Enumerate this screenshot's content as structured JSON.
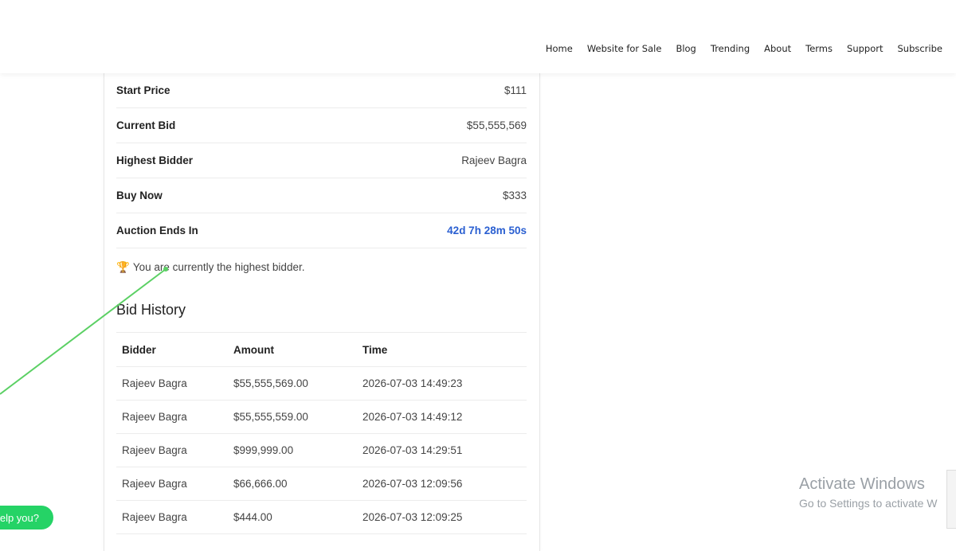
{
  "nav": {
    "items": [
      "Home",
      "Website for Sale",
      "Blog",
      "Trending",
      "About",
      "Terms",
      "Support",
      "Subscribe"
    ]
  },
  "auction": {
    "rows": [
      {
        "label": "Start Price",
        "value": "$111"
      },
      {
        "label": "Current Bid",
        "value": "$55,555,569"
      },
      {
        "label": "Highest Bidder",
        "value": "Rajeev Bagra"
      },
      {
        "label": "Buy Now",
        "value": "$333"
      },
      {
        "label": "Auction Ends In",
        "value": "42d 7h 28m 50s"
      }
    ],
    "status_text": "You are currently the highest bidder.",
    "status_icon": "trophy-icon"
  },
  "history": {
    "title": "Bid History",
    "columns": [
      "Bidder",
      "Amount",
      "Time"
    ],
    "rows": [
      [
        "Rajeev Bagra",
        "$55,555,569.00",
        "2026-07-03 14:49:23"
      ],
      [
        "Rajeev Bagra",
        "$55,555,559.00",
        "2026-07-03 14:49:12"
      ],
      [
        "Rajeev Bagra",
        "$999,999.00",
        "2026-07-03 14:29:51"
      ],
      [
        "Rajeev Bagra",
        "$66,666.00",
        "2026-07-03 12:09:56"
      ],
      [
        "Rajeev Bagra",
        "$444.00",
        "2026-07-03 12:09:25"
      ]
    ]
  },
  "chat": {
    "label": "elp you?"
  },
  "windows": {
    "line1": "Activate Windows",
    "line2": "Go to Settings to activate W"
  },
  "colors": {
    "countdown": "#2a5fd1",
    "chat": "#25d366",
    "annotation": "#5bd064"
  }
}
